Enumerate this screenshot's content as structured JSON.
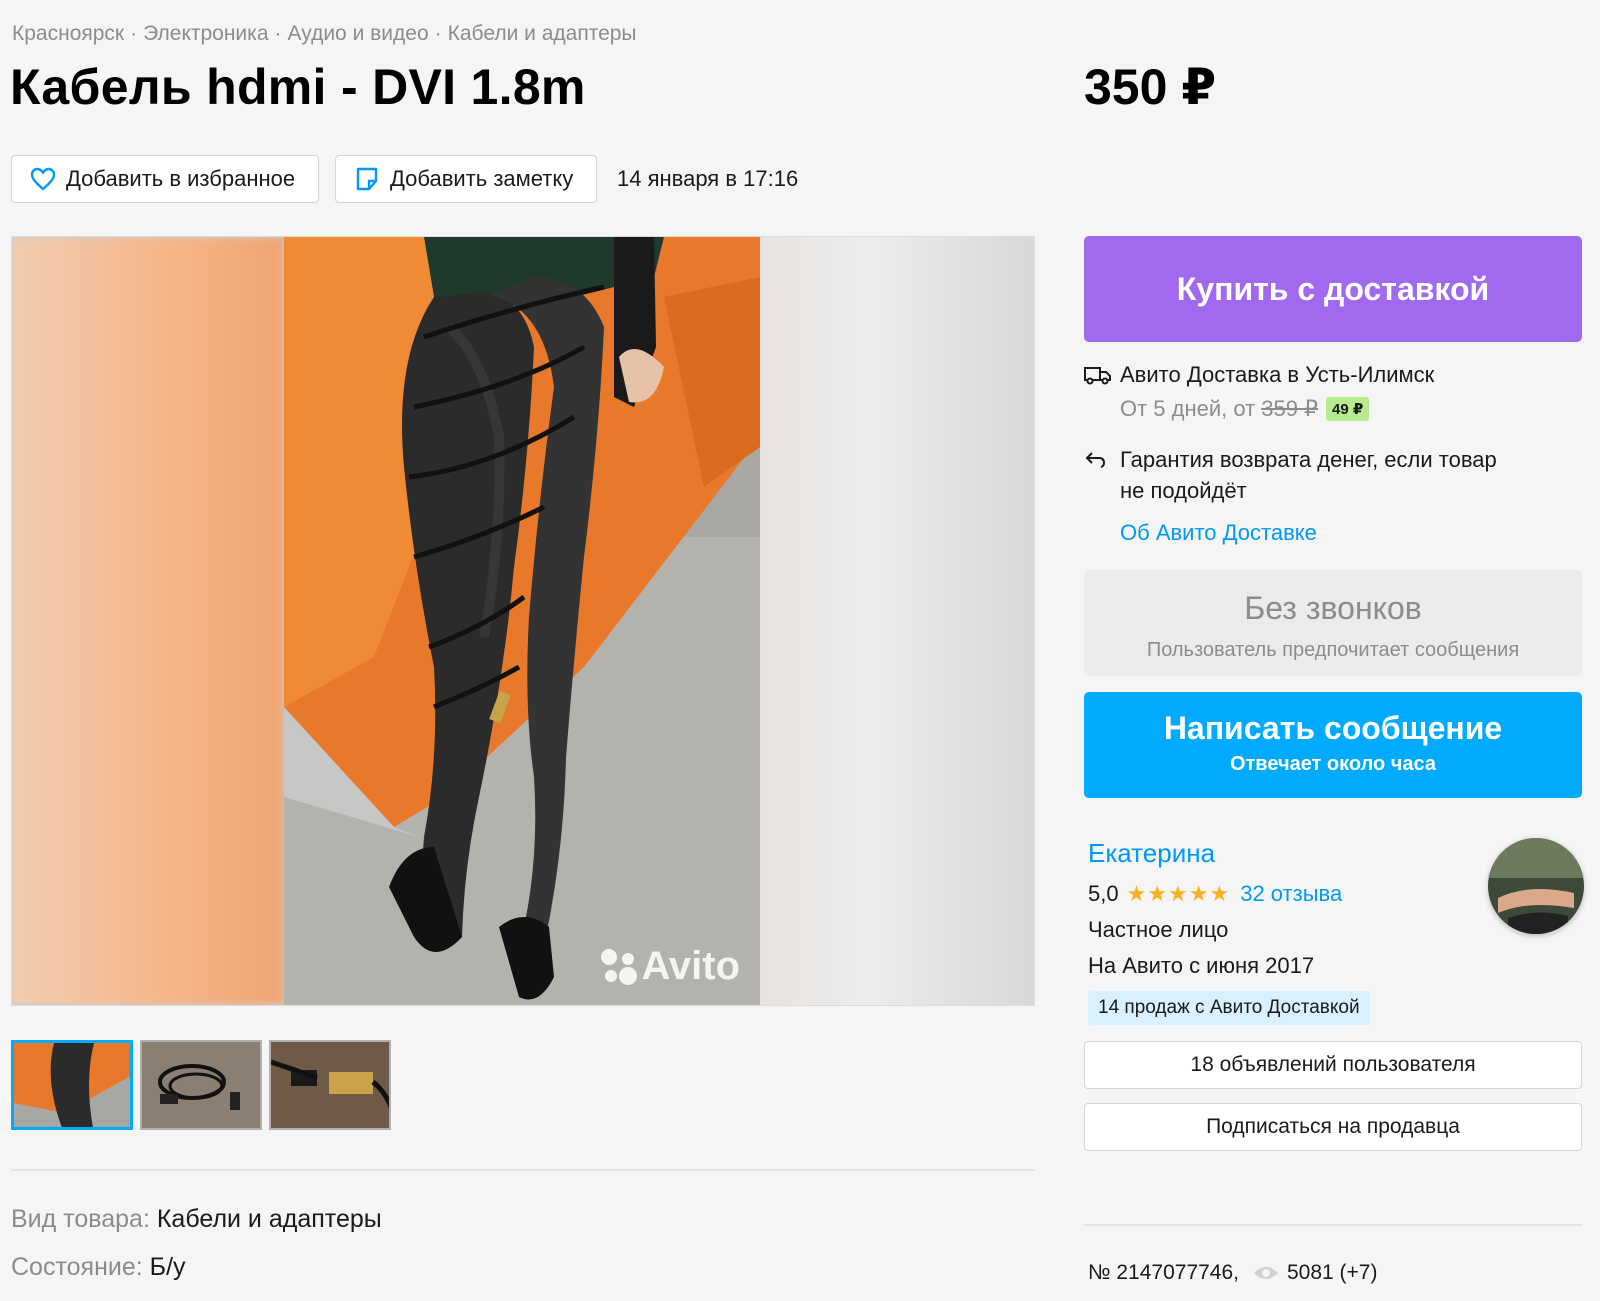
{
  "breadcrumbs": [
    "Красноярск",
    "Электроника",
    "Аудио и видео",
    "Кабели и адаптеры"
  ],
  "breadcrumb_separator": "·",
  "title": "Кабель hdmi - DVI 1.8m",
  "price": "350 ₽",
  "actions": {
    "favorite_label": "Добавить в избранное",
    "note_label": "Добавить заметку",
    "date": "14 января в 17:16"
  },
  "gallery": {
    "watermark": "Avito",
    "thumbnails": [
      "thumb-1",
      "thumb-2",
      "thumb-3"
    ],
    "active_index": 0
  },
  "params": [
    {
      "key": "Вид товара:",
      "value": "Кабели и адаптеры"
    },
    {
      "key": "Состояние:",
      "value": "Б/у"
    }
  ],
  "buy_button": "Купить с доставкой",
  "delivery": {
    "title": "Авито Доставка в Усть-Илимск",
    "terms": "От 5 дней, от",
    "old_price": "359 ₽",
    "new_price": "49 ₽",
    "guarantee": "Гарантия возврата денег, если товар не подойдёт",
    "about_link": "Об Авито Доставке"
  },
  "no_calls": {
    "title": "Без звонков",
    "subtitle": "Пользователь предпочитает сообщения"
  },
  "message_button": {
    "title": "Написать сообщение",
    "subtitle": "Отвечает около часа"
  },
  "seller": {
    "name": "Екатерина",
    "rating": "5,0",
    "stars": "★★★★★",
    "reviews": "32 отзыва",
    "type": "Частное лицо",
    "since": "На Авито с июня 2017",
    "sales_badge": "14 продаж с Авито Доставкой"
  },
  "ads_button": "18 объявлений пользователя",
  "subscribe_button": "Подписаться на продавца",
  "meta": {
    "number": "№ 2147077746,",
    "views": "5081 (+7)"
  },
  "colors": {
    "buy": "#a168f0",
    "message": "#00aaff",
    "link": "#0099f7",
    "star": "#ffb021",
    "delivery_badge": "#b7eb8f",
    "sales_badge": "#d9f0ff"
  }
}
